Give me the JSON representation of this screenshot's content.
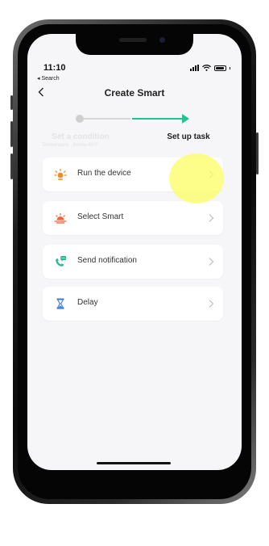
{
  "status_bar": {
    "time": "11:10",
    "back_app": "◂ Search"
  },
  "nav": {
    "title": "Create Smart"
  },
  "stepper": {
    "step1_label": "Set a condition",
    "step1_subtitle": "Temperature : Below-40°F",
    "step2_label": "Set up task"
  },
  "tasks": [
    {
      "label": "Run the device",
      "icon": "sun-icon"
    },
    {
      "label": "Select Smart",
      "icon": "sunrise-icon"
    },
    {
      "label": "Send notification",
      "icon": "phone-message-icon"
    },
    {
      "label": "Delay",
      "icon": "hourglass-icon"
    }
  ],
  "colors": {
    "accent": "#22c38e",
    "highlight": "#fcfc62",
    "orange": "#f58a2a",
    "blue": "#3a7bd5"
  }
}
